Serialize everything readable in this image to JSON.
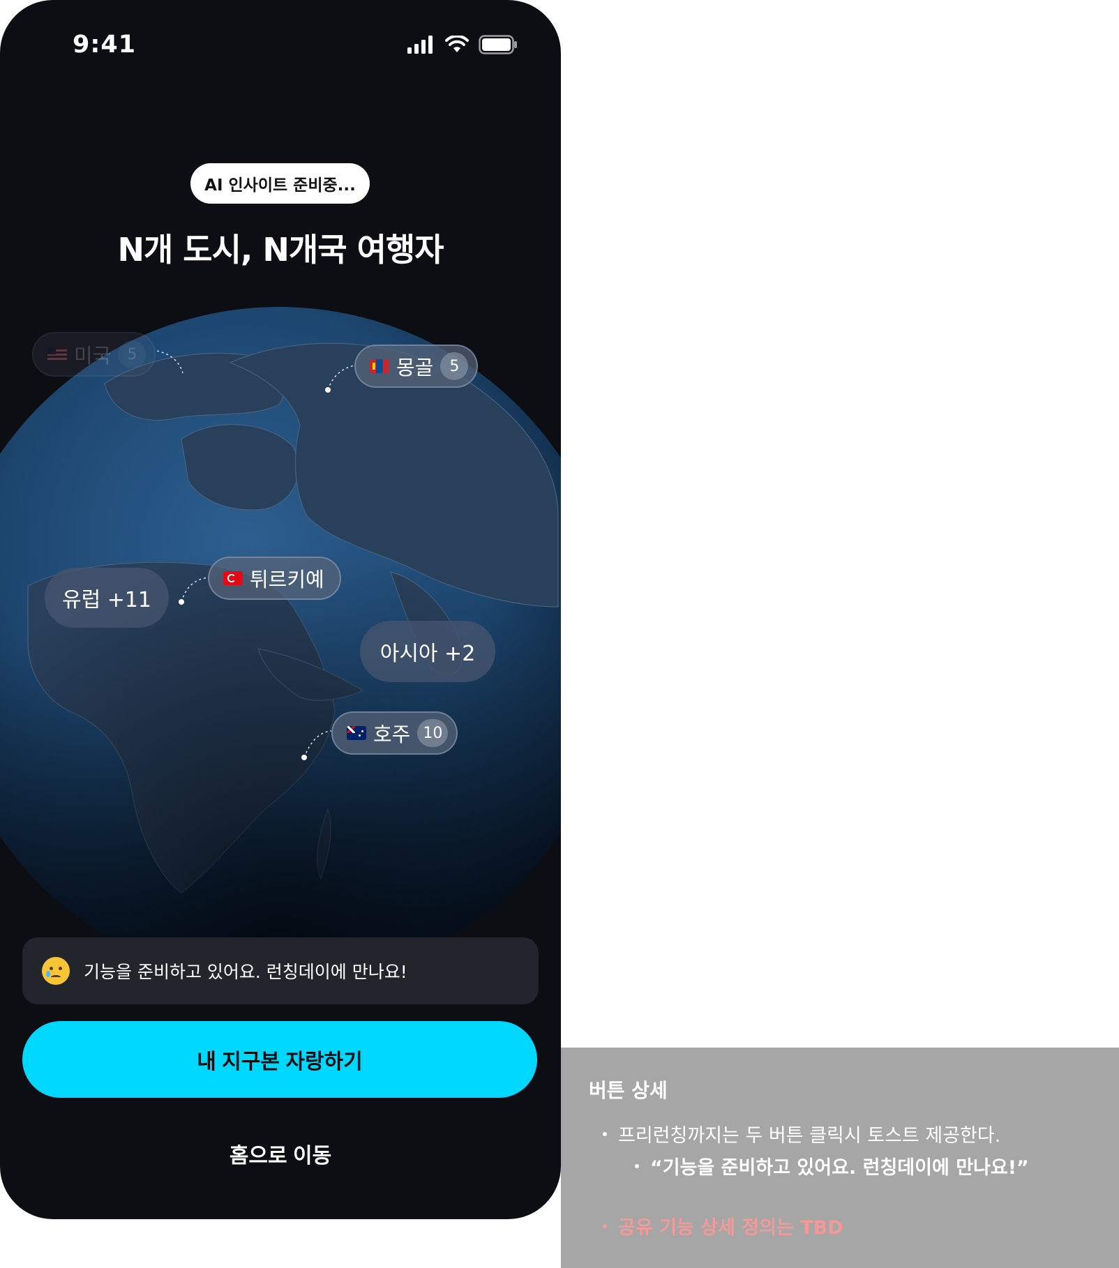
{
  "status_bar": {
    "time": "9:41"
  },
  "badge": {
    "label": "AI 인사이트 준비중..."
  },
  "headline": "N개 도시, N개국 여행자",
  "map": {
    "countries": [
      {
        "name": "미국",
        "count": "5",
        "faded": true
      },
      {
        "name": "몽골",
        "count": "5"
      },
      {
        "name": "튀르키예",
        "count": ""
      },
      {
        "name": "호주",
        "count": "10"
      }
    ],
    "regions": [
      {
        "label": "유럽 +11"
      },
      {
        "label": "아시아 +2"
      }
    ]
  },
  "toast": {
    "text": "기능을 준비하고 있어요. 런칭데이에 만나요!"
  },
  "buttons": {
    "primary": "내 지구본 자랑하기",
    "secondary": "홈으로 이동"
  },
  "note": {
    "title": "버튼 상세",
    "items": [
      "프리런칭까지는 두 버튼 클릭시 토스트 제공한다.",
      "“기능을 준비하고 있어요. 런칭데이에 만나요!”",
      "공유 기능 상세 정의는 TBD"
    ]
  },
  "colors": {
    "accent": "#00d7ff",
    "background": "#0d0d14",
    "note_bg": "#a6a6a6",
    "note_red": "#f29a9a"
  }
}
